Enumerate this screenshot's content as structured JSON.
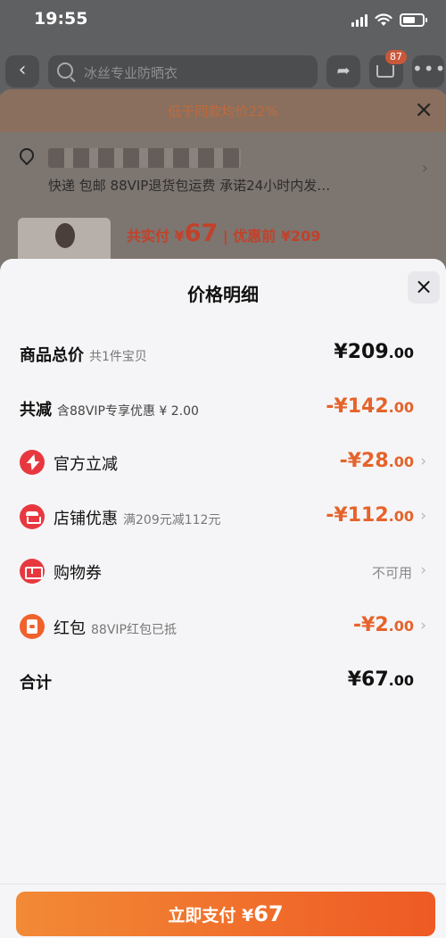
{
  "status_bar": {
    "time": "19:55"
  },
  "nav": {
    "back_glyph": "‹",
    "search_placeholder": "冰丝专业防晒衣",
    "share_glyph": "➦",
    "cart_badge": "87",
    "more_glyph": "•••"
  },
  "background_page": {
    "promo_text": "低于同款均价22%",
    "close_glyph": "×",
    "address_arrow": "›",
    "delivery_text": "快递 包邮 88VIP退货包运费 承诺24小时内发…",
    "price_prefix": "共实付 ¥",
    "price_value": "67",
    "price_suffix": " | 优惠前 ¥209"
  },
  "sheet": {
    "title": "价格明细",
    "close_glyph": "×",
    "rows": {
      "total": {
        "label": "商品总价",
        "sub": "共1件宝贝",
        "amount_main": "¥209",
        "amount_decimal": ".00"
      },
      "reduced": {
        "label": "共减",
        "sub": "含88VIP专享优惠 ¥ 2.00",
        "amount_main": "-¥142",
        "amount_decimal": ".00"
      },
      "official": {
        "label": "官方立减",
        "icon": "bolt-icon",
        "amount_main": "-¥28",
        "amount_decimal": ".00",
        "chevron": "›"
      },
      "shop": {
        "label": "店铺优惠",
        "icon": "shop-icon",
        "sub": "满209元减112元",
        "amount_main": "-¥112",
        "amount_decimal": ".00",
        "chevron": "›"
      },
      "coupon": {
        "label": "购物券",
        "icon": "ticket-icon",
        "status": "不可用",
        "chevron": "›"
      },
      "red_packet": {
        "label": "红包",
        "icon": "red-packet-icon",
        "sub": "88VIP红包已抵",
        "amount_main": "-¥2",
        "amount_decimal": ".00",
        "chevron": "›"
      },
      "sum": {
        "label": "合计",
        "amount_main": "¥67",
        "amount_decimal": ".00"
      }
    }
  },
  "pay_button": {
    "prefix": "立即支付 ¥",
    "amount": "67"
  },
  "colors": {
    "accent_orange": "#e5632b",
    "icon_red": "#e8383f",
    "button_gradient_start": "#f28a36",
    "button_gradient_end": "#ee5a24"
  }
}
